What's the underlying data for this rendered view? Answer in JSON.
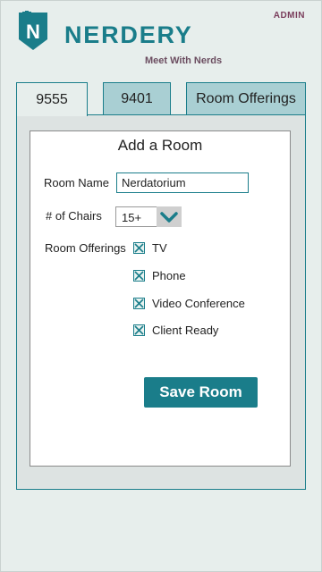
{
  "header": {
    "admin_label": "ADMIN",
    "brand_name": "NERDERY",
    "tagline": "Meet With Nerds",
    "brand_color": "#1a7d8a",
    "accent_color": "#7a3d5c"
  },
  "tabs": [
    {
      "label": "9555",
      "active": true
    },
    {
      "label": "9401",
      "active": false
    },
    {
      "label": "Room Offerings",
      "active": false
    }
  ],
  "form": {
    "title": "Add a Room",
    "room_name_label": "Room Name",
    "room_name_value": "Nerdatorium",
    "chairs_label": "# of Chairs",
    "chairs_value": "15+",
    "offerings_label": "Room Offerings",
    "offerings": [
      {
        "label": "TV",
        "checked": true
      },
      {
        "label": "Phone",
        "checked": true
      },
      {
        "label": "Video Conference",
        "checked": true
      },
      {
        "label": "Client Ready",
        "checked": true
      }
    ],
    "save_label": "Save Room"
  },
  "icons": {
    "logo": "nerdery-shield-logo",
    "dropdown": "chevron-down-icon",
    "checkbox": "checkbox-checked-icon"
  }
}
